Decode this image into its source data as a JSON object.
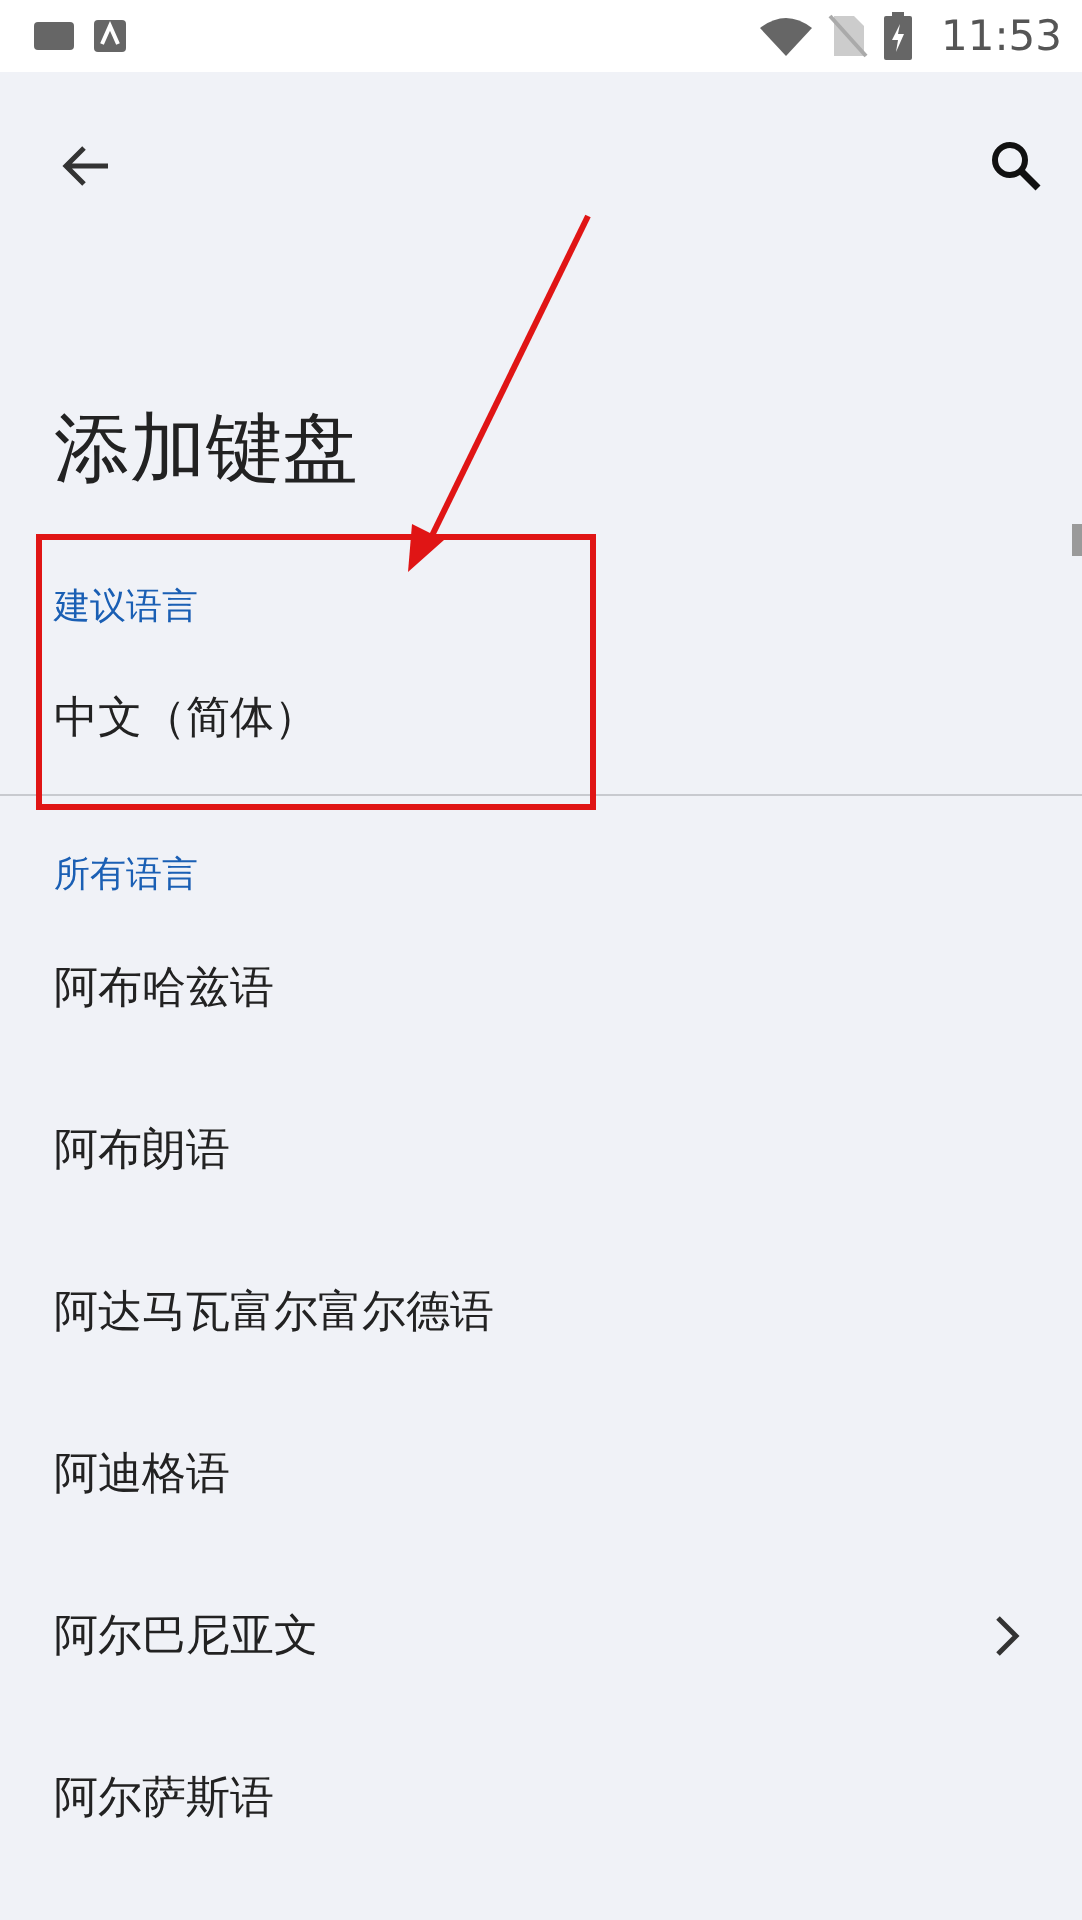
{
  "status_bar": {
    "time": "11:53"
  },
  "page": {
    "title": "添加键盘"
  },
  "sections": [
    {
      "header": "建议语言",
      "items": [
        {
          "label": "中文（简体）",
          "kind": "plain"
        }
      ]
    },
    {
      "header": "所有语言",
      "items": [
        {
          "label": "阿布哈兹语",
          "kind": "plain"
        },
        {
          "label": "阿布朗语",
          "kind": "plain"
        },
        {
          "label": "阿达马瓦富尔富尔德语",
          "kind": "plain"
        },
        {
          "label": "阿迪格语",
          "kind": "plain"
        },
        {
          "label": "阿尔巴尼亚文",
          "kind": "submenu"
        },
        {
          "label": "阿尔萨斯语",
          "kind": "plain"
        }
      ]
    }
  ]
}
